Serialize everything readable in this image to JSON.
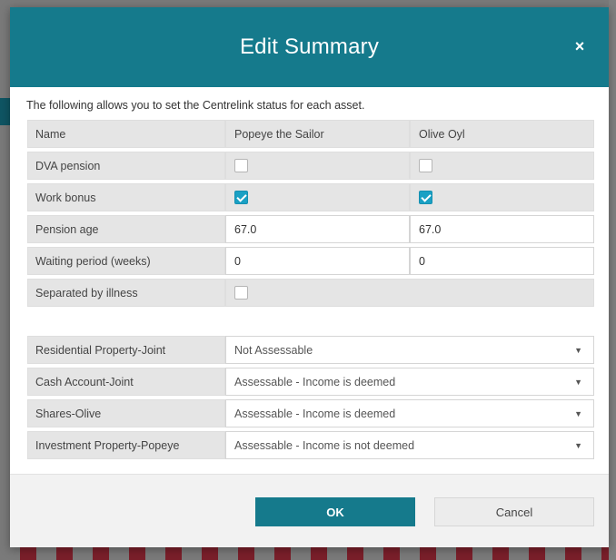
{
  "dialog": {
    "title": "Edit Summary",
    "close_label": "×",
    "intro": "The following allows you to set the Centrelink status for each asset."
  },
  "table": {
    "header": {
      "label": "Name",
      "person1": "Popeye the Sailor",
      "person2": "Olive Oyl"
    },
    "rows": [
      {
        "label": "DVA pension",
        "person1_checked": false,
        "person2_checked": false
      },
      {
        "label": "Work bonus",
        "person1_checked": true,
        "person2_checked": true
      },
      {
        "label": "Pension age",
        "person1_value": "67.0",
        "person2_value": "67.0"
      },
      {
        "label": "Waiting period (weeks)",
        "person1_value": "0",
        "person2_value": "0"
      },
      {
        "label": "Separated by illness",
        "checked": false
      }
    ]
  },
  "assets": [
    {
      "label": "Residential Property-Joint",
      "status": "Not Assessable"
    },
    {
      "label": "Cash Account-Joint",
      "status": "Assessable - Income is deemed"
    },
    {
      "label": "Shares-Olive",
      "status": "Assessable - Income is deemed"
    },
    {
      "label": "Investment Property-Popeye",
      "status": "Assessable - Income is not deemed"
    }
  ],
  "footer": {
    "ok_label": "OK",
    "cancel_label": "Cancel"
  },
  "colors": {
    "header": "#157a8c",
    "checkbox_checked": "#1aa0c4"
  }
}
